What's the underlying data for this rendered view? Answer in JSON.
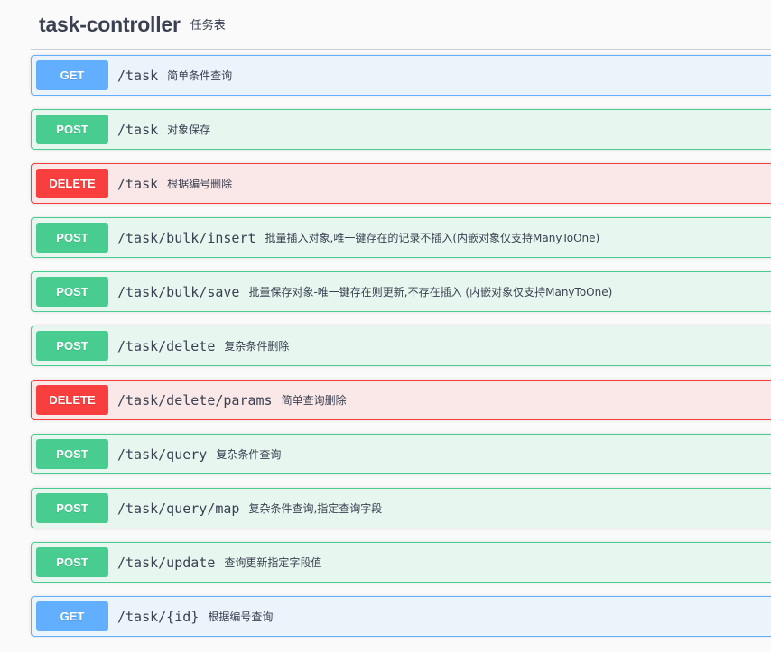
{
  "tag": {
    "name": "task-controller",
    "description": "任务表"
  },
  "operations": [
    {
      "method": "GET",
      "path": "/task",
      "summary": "简单条件查询"
    },
    {
      "method": "POST",
      "path": "/task",
      "summary": "对象保存"
    },
    {
      "method": "DELETE",
      "path": "/task",
      "summary": "根据编号删除"
    },
    {
      "method": "POST",
      "path": "/task/bulk/insert",
      "summary": "批量插入对象,唯一键存在的记录不插入(内嵌对象仅支持ManyToOne)"
    },
    {
      "method": "POST",
      "path": "/task/bulk/save",
      "summary": "批量保存对象-唯一键存在则更新,不存在插入 (内嵌对象仅支持ManyToOne)"
    },
    {
      "method": "POST",
      "path": "/task/delete",
      "summary": "复杂条件删除"
    },
    {
      "method": "DELETE",
      "path": "/task/delete/params",
      "summary": "简单查询删除"
    },
    {
      "method": "POST",
      "path": "/task/query",
      "summary": "复杂条件查询"
    },
    {
      "method": "POST",
      "path": "/task/query/map",
      "summary": "复杂条件查询,指定查询字段"
    },
    {
      "method": "POST",
      "path": "/task/update",
      "summary": "查询更新指定字段值"
    },
    {
      "method": "GET",
      "path": "/task/{id}",
      "summary": "根据编号查询"
    }
  ],
  "colors": {
    "get": "#61affe",
    "post": "#49cc90",
    "delete": "#f93e3e"
  }
}
